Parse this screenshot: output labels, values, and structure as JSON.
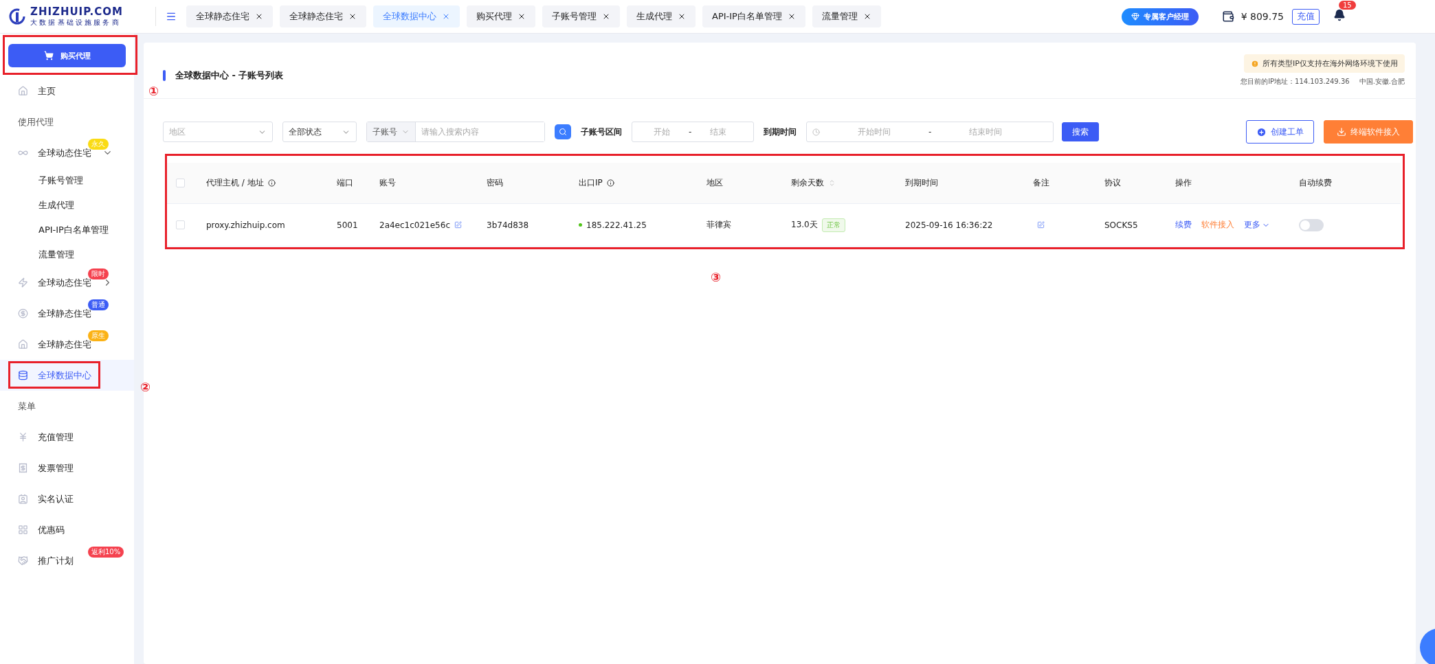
{
  "topbar": {
    "brand": "ZHIZHUIP.COM",
    "tagline": "大 数 据 基 础 设 施 服 务 商",
    "tabs": [
      {
        "label": "全球静态住宅",
        "selected": false
      },
      {
        "label": "全球静态住宅",
        "selected": false
      },
      {
        "label": "全球数据中心",
        "selected": true
      },
      {
        "label": "购买代理",
        "selected": false
      },
      {
        "label": "子账号管理",
        "selected": false
      },
      {
        "label": "生成代理",
        "selected": false
      },
      {
        "label": "API-IP白名单管理",
        "selected": false
      },
      {
        "label": "流量管理",
        "selected": false
      }
    ],
    "manager_button": "专属客户经理",
    "balance": "¥ 809.75",
    "recharge_button": "充值",
    "notification_count": "15"
  },
  "sidebar": {
    "buy_button": "购买代理",
    "items": [
      {
        "kind": "item",
        "label": "主页",
        "selected": false
      },
      {
        "kind": "section",
        "label": "使用代理"
      },
      {
        "kind": "item",
        "label": "全球动态住宅",
        "badge": "永久",
        "color": "#fadb14",
        "expanded": true,
        "selected": false
      },
      {
        "kind": "subitem",
        "label": "子账号管理"
      },
      {
        "kind": "subitem",
        "label": "生成代理"
      },
      {
        "kind": "subitem",
        "label": "API-IP白名单管理"
      },
      {
        "kind": "subitem",
        "label": "流量管理"
      },
      {
        "kind": "item",
        "label": "全球动态住宅",
        "badge": "限时",
        "color": "#f5424f",
        "expanded": false,
        "selected": false
      },
      {
        "kind": "item",
        "label": "全球静态住宅",
        "badge": "普通",
        "color": "#3c5cf5",
        "selected": false
      },
      {
        "kind": "item",
        "label": "全球静态住宅",
        "badge": "原生",
        "color": "#fbb215",
        "selected": false
      },
      {
        "kind": "item",
        "label": "全球数据中心",
        "selected": true
      },
      {
        "kind": "section",
        "label": "菜单"
      },
      {
        "kind": "item",
        "label": "充值管理",
        "selected": false
      },
      {
        "kind": "item",
        "label": "发票管理",
        "selected": false
      },
      {
        "kind": "item",
        "label": "实名认证",
        "selected": false
      },
      {
        "kind": "item",
        "label": "优惠码",
        "selected": false
      },
      {
        "kind": "item",
        "label": "推广计划",
        "badge": "返利10%",
        "color": "#f5424f",
        "selected": false
      }
    ]
  },
  "page": {
    "title": "全球数据中心 - 子账号列表",
    "notice": "所有类型IP仅支持在海外网络环境下使用",
    "ip_label": "您目前的IP地址：114.103.249.36",
    "ip_location": "中国.安徽.合肥"
  },
  "filters": {
    "region": {
      "placeholder": "地区"
    },
    "status": {
      "value": "全部状态"
    },
    "search_type": "子账号",
    "search": {
      "placeholder": "请输入搜索内容"
    },
    "range_label": "子账号区间",
    "range_start": {
      "placeholder": "开始"
    },
    "range_sep": "-",
    "range_end": {
      "placeholder": "结束"
    },
    "expiry_label": "到期时间",
    "expiry_start": {
      "placeholder": "开始时间"
    },
    "expiry_sep": "-",
    "expiry_end": {
      "placeholder": "结束时间"
    },
    "search_button": "搜索",
    "create_ticket_button": "创建工单",
    "client_button": "终端软件接入"
  },
  "table": {
    "columns": [
      {
        "label": "代理主机 / 地址",
        "info": true,
        "sortable": false
      },
      {
        "label": "端口",
        "info": false,
        "sortable": false
      },
      {
        "label": "账号",
        "info": false,
        "sortable": false
      },
      {
        "label": "密码",
        "info": false,
        "sortable": false
      },
      {
        "label": "出口IP",
        "info": true,
        "sortable": false
      },
      {
        "label": "地区",
        "info": false,
        "sortable": false
      },
      {
        "label": "剩余天数",
        "info": false,
        "sortable": true
      },
      {
        "label": "到期时间",
        "info": false,
        "sortable": false
      },
      {
        "label": "备注",
        "info": false,
        "sortable": false
      },
      {
        "label": "协议",
        "info": false,
        "sortable": false
      },
      {
        "label": "操作",
        "info": false,
        "sortable": false
      },
      {
        "label": "自动续费",
        "info": false,
        "sortable": false
      }
    ],
    "header_checked": false,
    "rows": [
      {
        "checked": false,
        "host": "proxy.zhizhuip.com",
        "port": "5001",
        "account": "2a4ec1c021e56c",
        "password": "3b74d838",
        "ip": "185.222.41.25",
        "color": "#52c41a",
        "region": "菲律宾",
        "days": "13.0天",
        "status": "正常",
        "expiry": "2025-09-16 16:36:22",
        "protocol": "SOCKS5",
        "renew": "续费",
        "software": "软件接入",
        "more": "更多",
        "auto_renew": false
      }
    ]
  },
  "annotations": [
    "①",
    "②",
    "③"
  ]
}
